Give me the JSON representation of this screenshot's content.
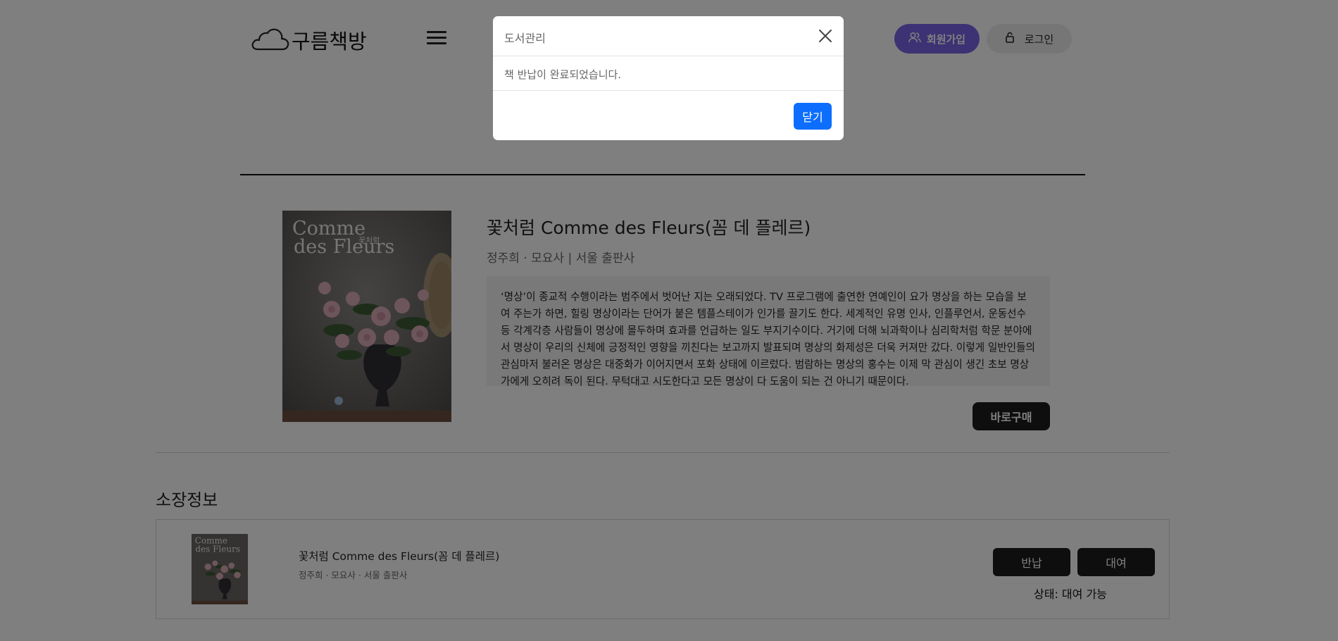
{
  "header": {
    "logo_text": "구름책방",
    "signup_label": "회원가입",
    "login_label": "로그인"
  },
  "book": {
    "title": "꽃처럼 Comme des Fleurs(꼼 데 플레르)",
    "meta": "정주희 · 모요사 | 서울 출판사",
    "description": "‘명상’이 종교적 수행이라는 범주에서 벗어난 지는 오래되었다. TV 프로그램에 출연한 연예인이 요가 명상을 하는 모습을 보여 주는가 하면, 힐링 명상이라는 단어가 붙은 템플스테이가 인가를 끌기도 한다. 세계적인 유명 인사, 인플루언서, 운동선수 등 각계각층 사람들이 명상에 몰두하며 효과를 언급하는 일도 부지기수이다. 거기에 더해 뇌과학이나 심리학처럼 학문 분야에서 명상이 우리의 신체에 긍정적인 영향을 끼친다는 보고까지 발표되며 명상의 화제성은 더욱 커져만 갔다. 이렇게 일반인들의 관심마저 불러온 명상은 대중화가 이어지면서 포화 상태에 이르렀다. 범람하는 명상의 홍수는 이제 막 관심이 생긴 초보 명상가에게 오히려 독이 된다. 무턱대고 시도한다고 모든 명상이 다 도움이 되는 건 아니기 때문이다.",
    "cover_title_line1": "Comme",
    "cover_title_line2": "des Fleurs",
    "cover_korean": "꽃처럼",
    "buy_label": "바로구매"
  },
  "holdings": {
    "section_title": "소장정보",
    "item": {
      "title": "꽃처럼 Comme des Fleurs(꼼 데 플레르)",
      "meta": "정주희 · 모요사 · 서울 출판사",
      "return_label": "반납",
      "rent_label": "대여",
      "status": "상태: 대여 가능"
    }
  },
  "modal": {
    "title": "도서관리",
    "message": "책 반납이 완료되었습니다.",
    "confirm_label": "닫기"
  },
  "colors": {
    "signup_bg": "#7a64e8",
    "primary_button": "#0d6efd",
    "dark_button": "#1c1c1c",
    "overlay": "rgba(0,0,0,0.5)"
  },
  "icons": {
    "logo": "cloud-icon",
    "menu": "hamburger-menu-icon",
    "signup": "user-group-icon",
    "login": "lock-icon",
    "close": "close-icon"
  }
}
